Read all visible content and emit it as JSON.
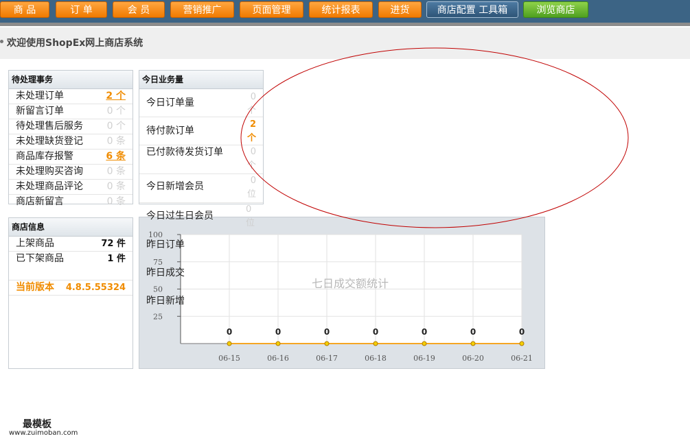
{
  "nav": {
    "tabs": [
      {
        "label": "商 品"
      },
      {
        "label": "订 单"
      },
      {
        "label": "会 员"
      },
      {
        "label": "营销推广"
      },
      {
        "label": "页面管理"
      },
      {
        "label": "统计报表"
      },
      {
        "label": "进货"
      },
      {
        "label": "商店配置  工具箱"
      },
      {
        "label": "浏览商店"
      }
    ]
  },
  "welcome": {
    "text": "欢迎使用ShopEx网上商店系统"
  },
  "pending": {
    "title": "待处理事务",
    "rows": [
      {
        "label": "未处理订单",
        "value": "2 个"
      },
      {
        "label": "新留言订单",
        "value": "0 个"
      },
      {
        "label": "待处理售后服务",
        "value": "0 个"
      },
      {
        "label": "未处理缺货登记",
        "value": "0 条"
      },
      {
        "label": "商品库存报警",
        "value": "6 条"
      },
      {
        "label": "未处理购买咨询",
        "value": "0 条"
      },
      {
        "label": "未处理商品评论",
        "value": "0 条"
      },
      {
        "label": "商店新留言",
        "value": "0 条"
      }
    ]
  },
  "business": {
    "title": "今日业务量",
    "rows": [
      {
        "label": "今日订单量",
        "value": "0 个"
      },
      {
        "label": "待付款订单",
        "value": "2 个"
      },
      {
        "label": "已付款待发货订单",
        "value": "0 个"
      },
      {
        "label": "今日新增会员",
        "value": "0 位"
      },
      {
        "label": "今日过生日会员",
        "value": "0 位"
      }
    ],
    "overflow": [
      "昨日订单",
      "昨日成交",
      "昨日新增"
    ]
  },
  "shop": {
    "title": "商店信息",
    "rows": [
      {
        "label": "上架商品",
        "value": "72 件"
      },
      {
        "label": "已下架商品",
        "value": "1 件"
      },
      {
        "label": "当前版本",
        "value": "4.8.5.55324"
      }
    ]
  },
  "chart_data": {
    "type": "line",
    "title": "七日成交额统计",
    "categories": [
      "06-15",
      "06-16",
      "06-17",
      "06-18",
      "06-19",
      "06-20",
      "06-21"
    ],
    "values": [
      0,
      0,
      0,
      0,
      0,
      0,
      0
    ],
    "value_labels": [
      "0",
      "0",
      "0",
      "0",
      "0",
      "0",
      "0"
    ],
    "yticks": [
      "100",
      "75",
      "50",
      "25"
    ],
    "ylim": [
      0,
      100
    ],
    "grid": true,
    "line_color": "#f5a623"
  },
  "footer": {
    "logo": "最模板",
    "url": "www.zuimoban.com"
  }
}
